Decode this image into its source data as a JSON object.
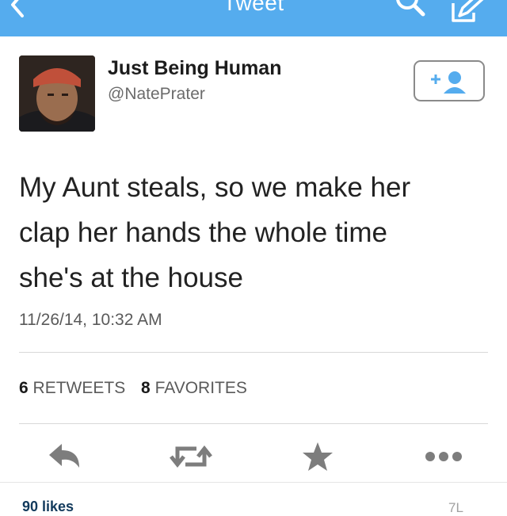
{
  "nav": {
    "title": "Tweet",
    "back_icon": "chevron-left-icon",
    "search_icon": "search-icon",
    "compose_icon": "compose-icon",
    "bar_color": "#55acee"
  },
  "tweet": {
    "display_name": "Just Being Human",
    "handle": "@NatePrater",
    "text_lines": [
      "My Aunt steals, so we make her",
      "clap her hands the whole time",
      "she's at the house"
    ],
    "timestamp": "11/26/14, 10:32 AM",
    "follow_icon": "add-user-icon"
  },
  "stats": {
    "retweets_count": "6",
    "retweets_label": "RETWEETS",
    "favorites_count": "8",
    "favorites_label": "FAVORITES"
  },
  "actions": [
    {
      "name": "reply-icon"
    },
    {
      "name": "retweet-icon"
    },
    {
      "name": "favorite-star-icon"
    },
    {
      "name": "more-dots-icon"
    }
  ],
  "footer": {
    "likes_text": "90 likes",
    "corner_text": "7L"
  }
}
